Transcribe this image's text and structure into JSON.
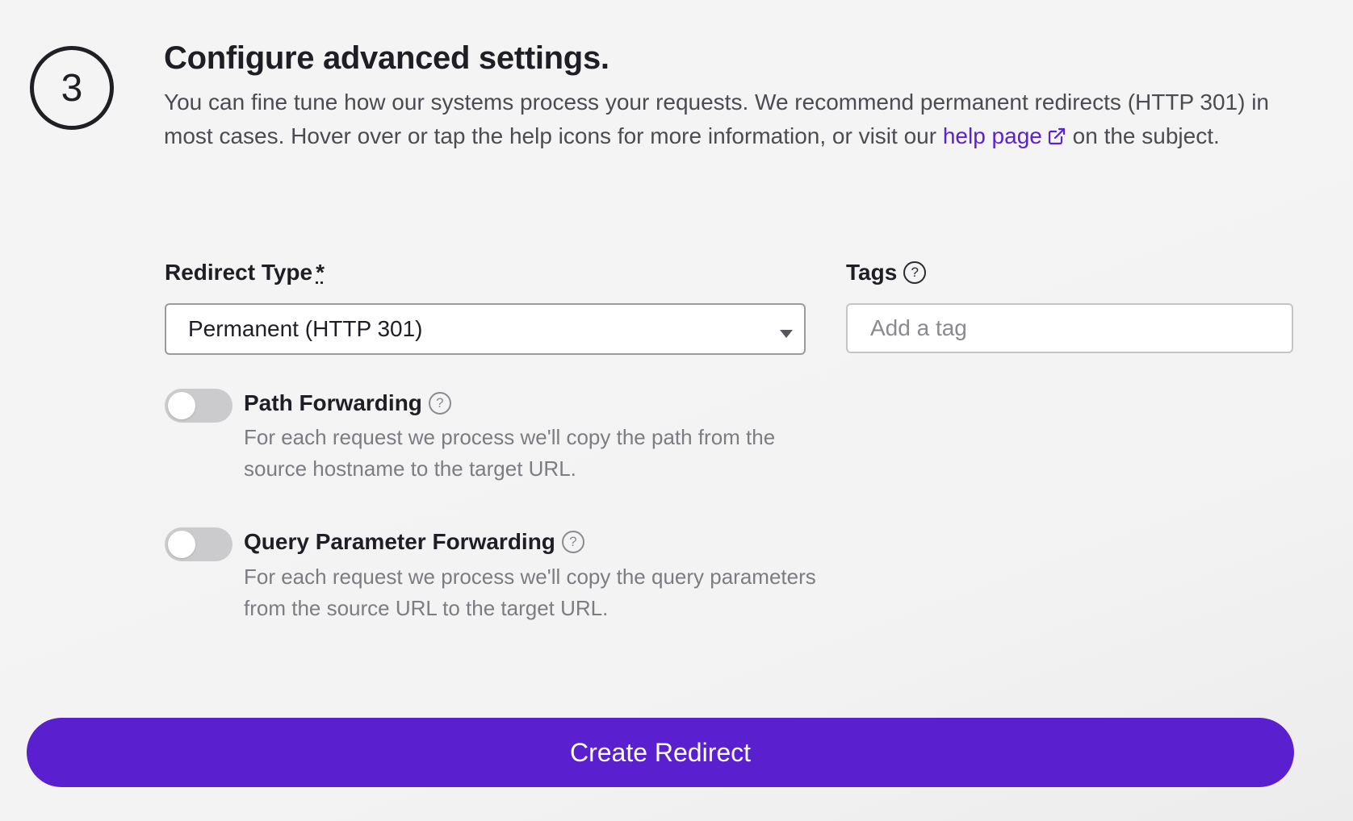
{
  "step": {
    "number": "3",
    "heading": "Configure advanced settings.",
    "description_before": "You can fine tune how our systems process your requests. We recommend permanent redirects (HTTP 301) in most cases. Hover over or tap the help icons for more information, or visit our",
    "help_link_label": "help page",
    "description_after": "on the subject."
  },
  "redirect_type": {
    "label": "Redirect Type",
    "required_marker": "*",
    "selected": "Permanent (HTTP 301)"
  },
  "tags": {
    "label": "Tags",
    "placeholder": "Add a tag"
  },
  "toggles": [
    {
      "label": "Path Forwarding",
      "description": "For each request we process we'll copy the path from the source hostname to the target URL."
    },
    {
      "label": "Query Parameter Forwarding",
      "description": "For each request we process we'll copy the query parameters from the source URL to the target URL."
    }
  ],
  "help_glyph": "?",
  "submit_label": "Create Redirect",
  "colors": {
    "accent": "#5a1fcf",
    "link": "#5a22d4",
    "toggle_off": "#cbcbcd"
  },
  "icons": {
    "external_link": "external-link-icon",
    "help": "help-circle-icon"
  }
}
